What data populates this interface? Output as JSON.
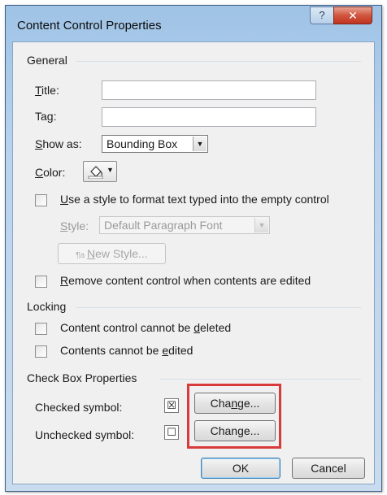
{
  "window": {
    "title": "Content Control Properties",
    "help_glyph": "?",
    "close_glyph": "✕"
  },
  "general": {
    "heading": "General",
    "title_label": {
      "key": "T",
      "rest": "itle:"
    },
    "title_value": "",
    "tag_label": {
      "pre": "Ta",
      "key": "g",
      "rest": ":"
    },
    "tag_value": "",
    "show_as_label": {
      "key": "S",
      "rest": "how as:"
    },
    "show_as_value": "Bounding Box",
    "color_label": {
      "key": "C",
      "rest": "olor:"
    },
    "use_style": {
      "key": "U",
      "rest": "se a style to format text typed into the empty control",
      "checked": false
    },
    "style_label": {
      "key": "S",
      "rest": "tyle:"
    },
    "style_value": "Default Paragraph Font",
    "new_style_button": {
      "key": "N",
      "rest": "ew Style..."
    },
    "remove_control": {
      "key": "R",
      "rest": "emove content control when contents are edited",
      "checked": false
    }
  },
  "locking": {
    "heading": "Locking",
    "cannot_delete": {
      "pre": "Content control cannot be ",
      "key": "d",
      "rest": "eleted",
      "checked": false
    },
    "cannot_edit": {
      "pre": "Contents cannot be ",
      "key": "e",
      "rest": "dited",
      "checked": false
    }
  },
  "checkbox_props": {
    "heading": "Check Box Properties",
    "checked_label": "Checked symbol:",
    "checked_symbol": "☒",
    "unchecked_label": "Unchecked symbol:",
    "unchecked_symbol": "☐",
    "change_checked": {
      "pre": "Cha",
      "key": "n",
      "rest": "ge..."
    },
    "change_unchecked": {
      "pre": "Chan",
      "key": "g",
      "rest": "e..."
    }
  },
  "footer": {
    "ok_label": "OK",
    "cancel_label": "Cancel"
  },
  "colors": {
    "highlight": "#d93a3a",
    "close_button": "#c0341f",
    "titlebar": "#b9d3ee"
  }
}
